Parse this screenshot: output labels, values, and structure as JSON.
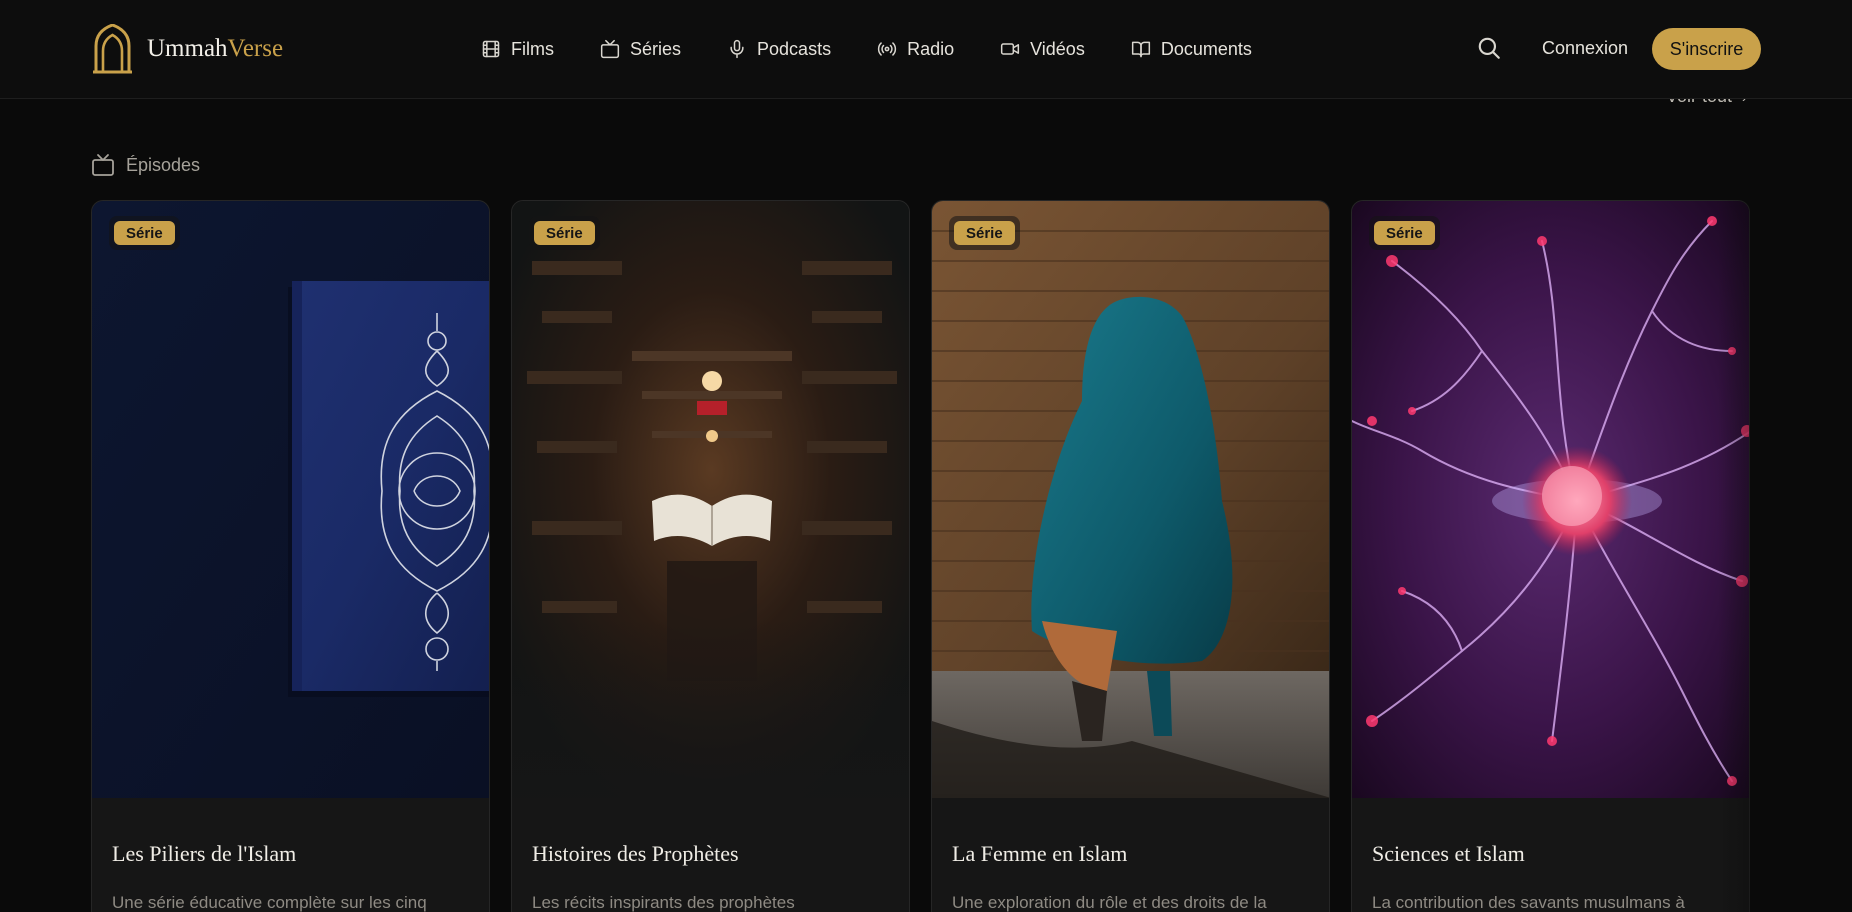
{
  "brand": {
    "name_part1": "Ummah",
    "name_part2": "Verse"
  },
  "nav": [
    {
      "label": "Films",
      "icon": "film-icon"
    },
    {
      "label": "Séries",
      "icon": "tv-icon"
    },
    {
      "label": "Podcasts",
      "icon": "microphone-icon"
    },
    {
      "label": "Radio",
      "icon": "radio-icon"
    },
    {
      "label": "Vidéos",
      "icon": "video-icon"
    },
    {
      "label": "Documents",
      "icon": "book-icon"
    }
  ],
  "header": {
    "login_label": "Connexion",
    "signup_label": "S'inscrire"
  },
  "see_all": {
    "label": "Voir tout",
    "chevron": "›"
  },
  "section": {
    "title": "Épisodes",
    "icon": "tv-icon"
  },
  "cards": [
    {
      "badge": "Série",
      "title": "Les Piliers de l'Islam",
      "description": "Une série éducative complète sur les cinq",
      "image": "quran-cover"
    },
    {
      "badge": "Série",
      "title": "Histoires des Prophètes",
      "description": "Les récits inspirants des prophètes",
      "image": "library-book"
    },
    {
      "badge": "Série",
      "title": "La Femme en Islam",
      "description": "Une exploration du rôle et des droits de la",
      "image": "woman-in-veil"
    },
    {
      "badge": "Série",
      "title": "Sciences et Islam",
      "description": "La contribution des savants musulmans à",
      "image": "plasma-ball"
    }
  ],
  "colors": {
    "accent": "#c9a14a",
    "background": "#0a0a0a",
    "card": "#161616"
  }
}
